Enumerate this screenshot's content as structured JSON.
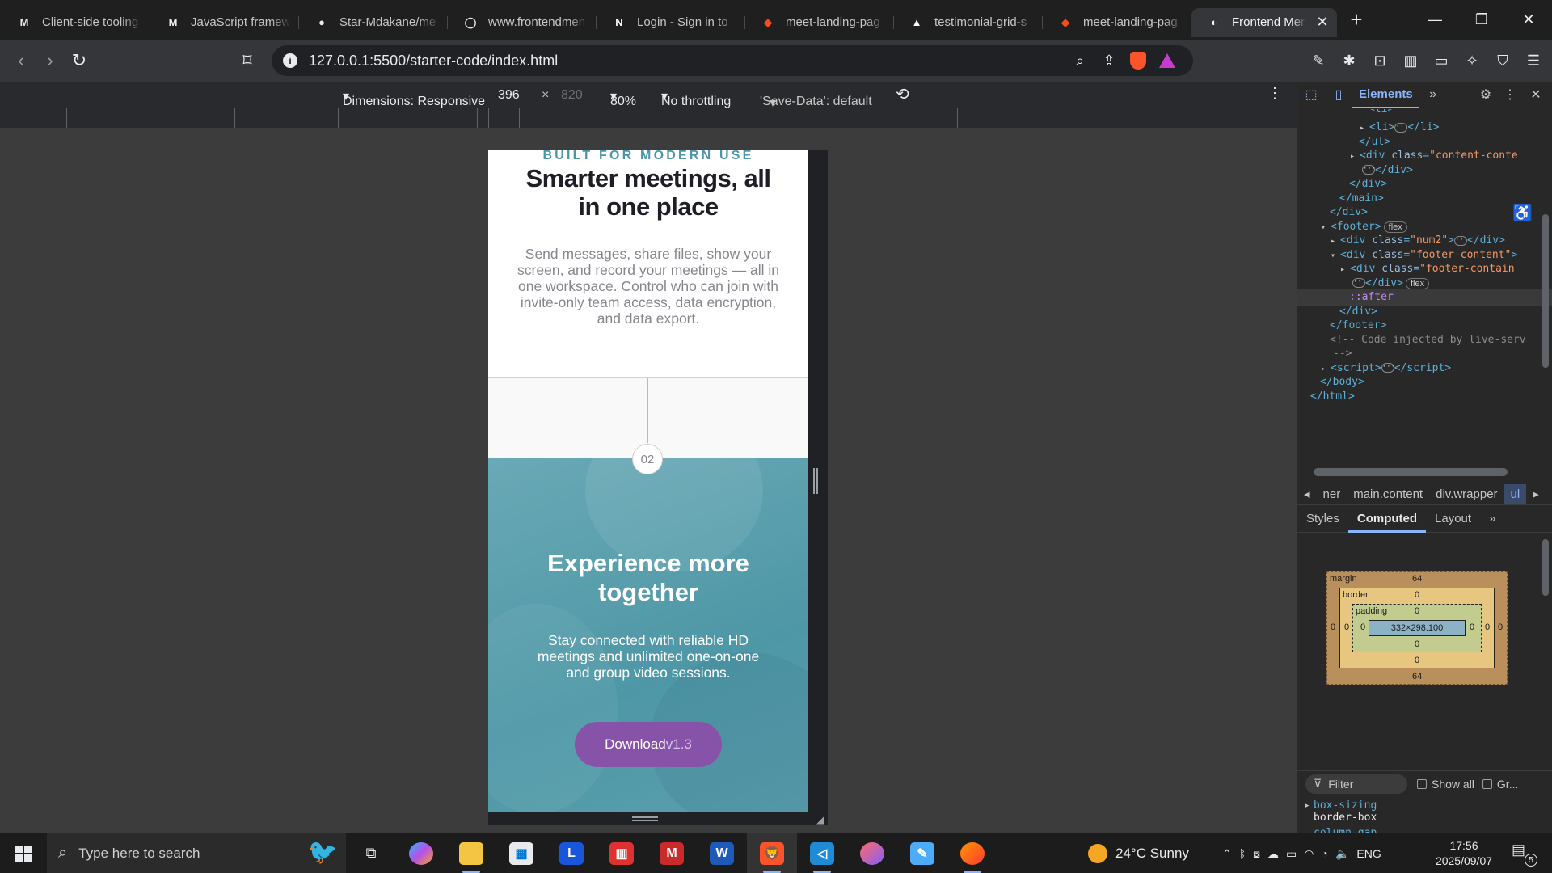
{
  "tabs": [
    {
      "title": "Client-side tooling",
      "icon": "M",
      "color": "#e8eaed"
    },
    {
      "title": "JavaScript framew",
      "icon": "M",
      "color": "#e8eaed"
    },
    {
      "title": "Star-Mdakane/me",
      "icon": "github-icon",
      "color": "#e8eaed"
    },
    {
      "title": "www.frontendmen",
      "icon": "circle-icon",
      "color": "#e8eaed"
    },
    {
      "title": "Login - Sign in to",
      "icon": "notion-icon",
      "color": "#ffffff"
    },
    {
      "title": "meet-landing-pag",
      "icon": "figma-icon",
      "color": "#f24e1e"
    },
    {
      "title": "testimonial-grid-s",
      "icon": "vercel-icon",
      "color": "#ffffff"
    },
    {
      "title": "meet-landing-pag",
      "icon": "figma-icon",
      "color": "#f24e1e"
    },
    {
      "title": "Frontend Men",
      "icon": "fm-icon",
      "color": "#ffffff",
      "active": true
    }
  ],
  "address": {
    "url": "127.0.0.1:5500/starter-code/index.html"
  },
  "device_toolbar": {
    "dimensions": "Dimensions: Responsive",
    "width": "396",
    "times": "×",
    "height": "820",
    "zoom": "80%",
    "throttling": "No throttling",
    "save_data": "'Save-Data': default"
  },
  "page": {
    "eyebrow": "BUILT FOR MODERN USE",
    "hero_title": "Smarter meetings, all in one place",
    "hero_body": "Send messages, share files, show your screen, and record your meetings — all in one workspace. Control who can join with invite-only team access, data encryption, and data export.",
    "step_number": "02",
    "cta_title": "Experience more together",
    "cta_body": "Stay connected with reliable HD meetings and unlimited one-on-one and group video sessions.",
    "cta_button": "Download",
    "cta_button_version": "v1.3",
    "colors": {
      "accent_cyan": "#4d96a9",
      "button_purple": "#8653a8"
    }
  },
  "devtools": {
    "active_tab": "Elements",
    "dom_lines": [
      {
        "html": "<span class=\"t\">&lt;li&gt;</span><span class=\"ell\">···</span><span class=\"t\">&lt;/li&gt;</span>",
        "indent": 88,
        "arrow": "▸"
      },
      {
        "html": "<span class=\"t\">&lt;/ul&gt;</span>",
        "indent": 76
      },
      {
        "html": "<span class=\"t\">&lt;div </span><span class=\"a\">class</span><span class=\"t\">=</span><span class=\"v\">\"content-conte</span>",
        "indent": 76,
        "arrow": "▸"
      },
      {
        "html": "<span class=\"ell\">···</span><span class=\"t\">&lt;/div&gt;</span>",
        "indent": 80
      },
      {
        "html": "<span class=\"t\">&lt;/div&gt;</span>",
        "indent": 64
      },
      {
        "html": "<span class=\"t\">&lt;/main&gt;</span>",
        "indent": 52
      },
      {
        "html": "<span class=\"t\">&lt;/div&gt;</span>",
        "indent": 40
      },
      {
        "html": "<span class=\"t\">&lt;footer&gt;</span><span class=\"badge\">flex</span>",
        "indent": 40,
        "arrow": "▾"
      },
      {
        "html": "<span class=\"t\">&lt;div </span><span class=\"a\">class</span><span class=\"t\">=</span><span class=\"v\">\"num2\"</span><span class=\"t\">&gt;</span><span class=\"ell\">···</span><span class=\"t\">&lt;/div&gt;</span>",
        "indent": 52,
        "arrow": "▸"
      },
      {
        "html": "<span class=\"t\">&lt;div </span><span class=\"a\">class</span><span class=\"t\">=</span><span class=\"v\">\"footer-content\"</span><span class=\"t\">&gt;</span>",
        "indent": 52,
        "arrow": "▾"
      },
      {
        "html": "<span class=\"t\">&lt;div </span><span class=\"a\">class</span><span class=\"t\">=</span><span class=\"v\">\"footer-contain</span>",
        "indent": 64,
        "arrow": "▸"
      },
      {
        "html": "<span class=\"ell\">···</span><span class=\"t\">&lt;/div&gt;</span><span class=\"badge\">flex</span>",
        "indent": 68
      },
      {
        "html": "<span class=\"ps\">::after</span>",
        "indent": 64,
        "sel": true
      },
      {
        "html": "<span class=\"t\">&lt;/div&gt;</span>",
        "indent": 52
      },
      {
        "html": "<span class=\"t\">&lt;/footer&gt;</span>",
        "indent": 40
      },
      {
        "html": "<span class=\"c\">&lt;!-- Code injected by live-serv</span>",
        "indent": 40
      },
      {
        "html": "<span class=\"c\">--&gt;</span>",
        "indent": 44
      },
      {
        "html": "<span class=\"t\">&lt;script&gt;</span><span class=\"ell\">···</span><span class=\"t\">&lt;/script&gt;</span>",
        "indent": 40,
        "arrow": "▸"
      },
      {
        "html": "<span class=\"t\">&lt;/body&gt;</span>",
        "indent": 28
      },
      {
        "html": "<span class=\"t\">&lt;/html&gt;</span>",
        "indent": 16
      }
    ],
    "breadcrumbs": [
      "ner",
      "main.content",
      "div.wrapper",
      "ul"
    ],
    "subtabs": [
      "Styles",
      "Computed",
      "Layout"
    ],
    "active_subtab": "Computed",
    "box_model": {
      "margin_label": "margin",
      "margin_top": "64",
      "margin_bottom": "64",
      "margin_left": "0",
      "margin_right": "0",
      "border_label": "border",
      "border_top": "0",
      "border_bottom": "0",
      "border_left": "0",
      "border_right": "0",
      "padding_label": "padding",
      "padding_top": "0",
      "padding_bottom": "0",
      "padding_left": "0",
      "padding_right": "0",
      "content": "332×298.100"
    },
    "filter_placeholder": "Filter",
    "show_all": "Show all",
    "group": "Gr...",
    "css": [
      {
        "prop": "box-sizing",
        "value": "border-box"
      },
      {
        "prop": "column-gap",
        "value": ""
      }
    ]
  },
  "taskbar": {
    "search_placeholder": "Type here to search",
    "weather": "24°C  Sunny",
    "language": "ENG",
    "time": "17:56",
    "date": "2025/09/07",
    "notifications": "5"
  }
}
